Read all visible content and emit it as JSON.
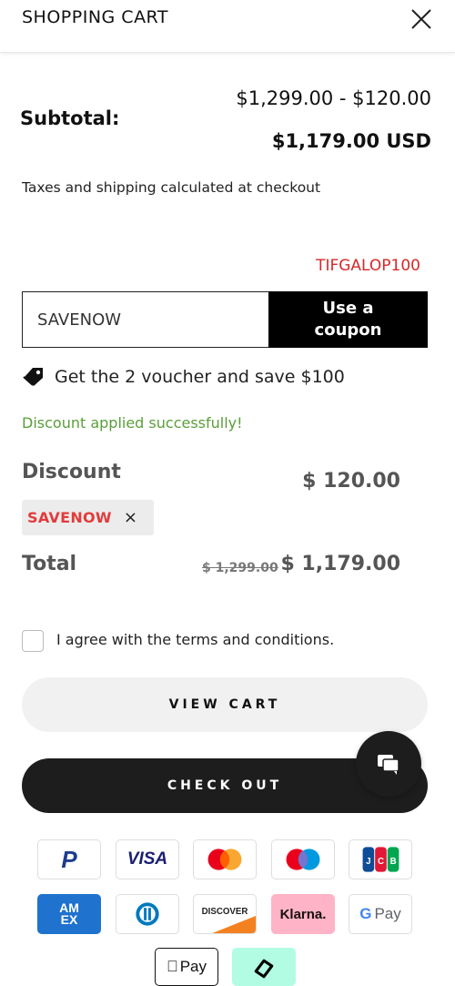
{
  "header": {
    "title": "SHOPPING CART"
  },
  "summary": {
    "subtotal_label": "Subtotal:",
    "subtotal_calc": "$1,299.00 - $120.00",
    "subtotal_total": "$1,179.00 USD",
    "tax_note": "Taxes and shipping calculated at checkout"
  },
  "coupon": {
    "hint_code": "TIFGALOP100",
    "input_value": "SAVENOW",
    "button_label_line1": "Use a",
    "button_label_line2": "coupon",
    "voucher_text": "Get the 2 voucher and save $100",
    "success_message": "Discount applied successfully!"
  },
  "discount": {
    "label": "Discount",
    "amount": "$ 120.00",
    "applied_code": "SAVENOW",
    "remove_symbol": "×"
  },
  "total": {
    "label": "Total",
    "original": "$ 1,299.00",
    "final": "$ 1,179.00"
  },
  "terms": {
    "label": "I agree with the terms and conditions.",
    "checked": false
  },
  "actions": {
    "view_cart": "VIEW CART",
    "checkout": "CHECK OUT"
  },
  "payment_methods": [
    {
      "name": "PayPal",
      "icon": "paypal-icon"
    },
    {
      "name": "VISA",
      "icon": "visa-icon"
    },
    {
      "name": "Mastercard",
      "icon": "mastercard-icon"
    },
    {
      "name": "Maestro",
      "icon": "maestro-icon"
    },
    {
      "name": "JCB",
      "icon": "jcb-icon"
    },
    {
      "name": "AMEX",
      "icon": "amex-icon"
    },
    {
      "name": "Diners Club",
      "icon": "diners-icon"
    },
    {
      "name": "DISCOVER",
      "icon": "discover-icon"
    },
    {
      "name": "Klarna.",
      "icon": "klarna-icon"
    },
    {
      "name": "G Pay",
      "icon": "google-pay-icon"
    },
    {
      "name": "Pay",
      "icon": "apple-pay-icon"
    },
    {
      "name": "Afterpay",
      "icon": "afterpay-icon"
    }
  ],
  "colors": {
    "accent_red": "#d62828",
    "success_green": "#5a9e3a",
    "button_dark": "#1d1d1d",
    "muted_text": "#555555"
  }
}
